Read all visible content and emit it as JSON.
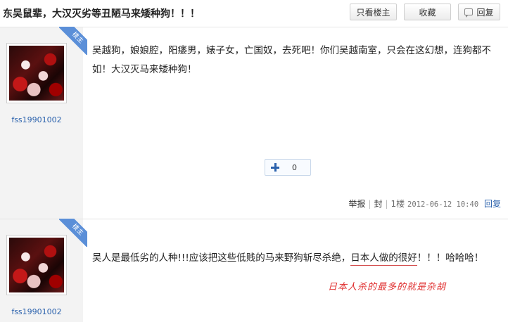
{
  "header": {
    "title": "东吴鼠辈，大汉灭劣等丑陋马来矮种狗！！！",
    "only_louzhu_label": "只看楼主",
    "favorite_label": "收藏",
    "reply_label": "回复"
  },
  "posts": [
    {
      "username": "fss19901002",
      "badge": "楼主",
      "text": "吴越狗，娘娘腔，阳痿男，婊子女，亡国奴，去死吧！你们吴越南室，只会在这幻想，连狗都不如！大汉灭马来矮种狗！",
      "like_count": "0",
      "report_label": "举报",
      "ban_label": "封",
      "floor": "1楼",
      "time": "2012-06-12 10:40",
      "reply_label": "回复"
    },
    {
      "username": "fss19901002",
      "badge": "楼主",
      "text_before": "吴人是最低劣的人种!!!应该把这些低贱的马来野狗斩尽杀绝，",
      "text_underlined": "日本人做的很好",
      "text_after": "！！！哈哈哈！",
      "annotation": "日本人杀的最多的就是杂胡"
    }
  ],
  "colors": {
    "link": "#2b62ad",
    "badge": "#5b8fd8",
    "annotation": "#e03030"
  },
  "icons": [
    "reply-icon",
    "plus-icon",
    "avatar-image"
  ]
}
